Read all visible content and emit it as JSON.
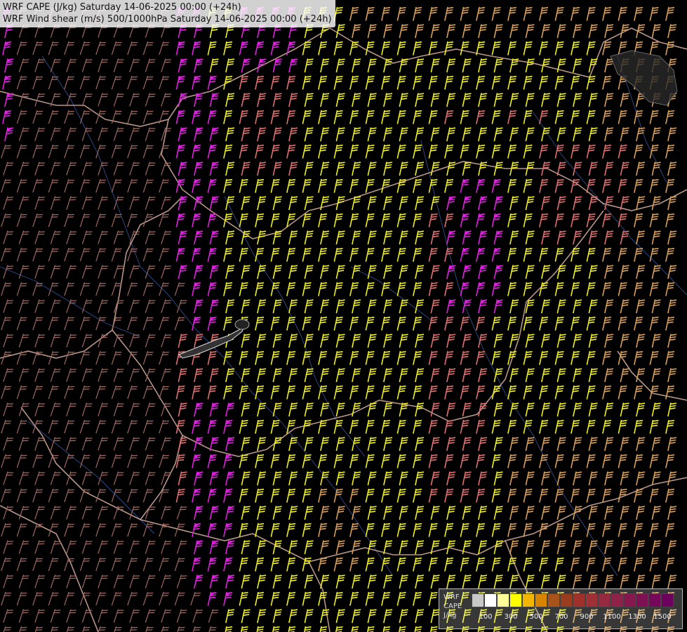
{
  "header": {
    "line1": "WRF CAPE (J/kg) Saturday 14-06-2025 00:00 (+24h)",
    "line2": "WRF Wind shear (m/s) 500/1000hPa Saturday 14-06-2025 00:00 (+24h)"
  },
  "legend": {
    "label_model": "WRF",
    "label_field": "CAPE",
    "label_unit": "J/kg",
    "swatches": [
      "#c8c8c8",
      "#ffffff",
      "#ffff9a",
      "#ffff00",
      "#f2b600",
      "#d98400",
      "#a8521c",
      "#9a3c20",
      "#a0302c",
      "#a03038",
      "#962a40",
      "#8e2248",
      "#86184e",
      "#7e1054",
      "#76085a",
      "#6e0060"
    ],
    "ticks": [
      {
        "label": "100",
        "index": 1
      },
      {
        "label": "300",
        "index": 3
      },
      {
        "label": "500",
        "index": 5
      },
      {
        "label": "700",
        "index": 7
      },
      {
        "label": "900",
        "index": 9
      },
      {
        "label": "1100",
        "index": 11
      },
      {
        "label": "1300",
        "index": 13
      },
      {
        "label": "1500",
        "index": 15
      }
    ]
  },
  "barb_colors": {
    "low": "#a06a62",
    "mid": "#e07070",
    "orange": "#d8a058",
    "yellow": "#f0f020",
    "magenta": "#e020e0"
  },
  "border_color": "#d8b0a0",
  "river_color": "#4060b0"
}
